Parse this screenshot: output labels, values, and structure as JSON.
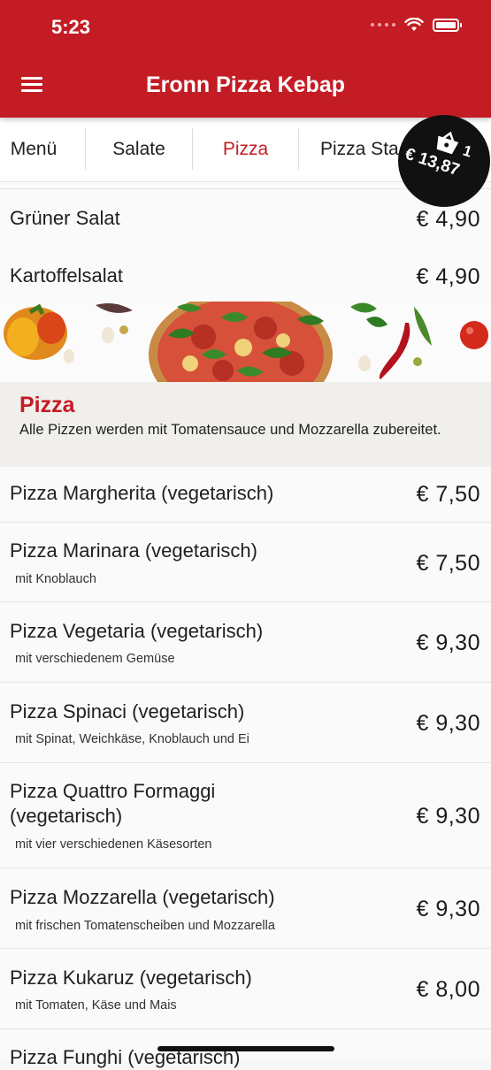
{
  "status": {
    "time": "5:23"
  },
  "header": {
    "title": "Eronn Pizza Kebap"
  },
  "tabs": [
    {
      "label": "Menü",
      "active": false
    },
    {
      "label": "Salate",
      "active": false
    },
    {
      "label": "Pizza",
      "active": true
    },
    {
      "label": "Pizza Sta",
      "active": false
    }
  ],
  "cart": {
    "count": "1",
    "total": "€ 13,87"
  },
  "salad_items": [
    {
      "name": "Grüner Salat",
      "price": "€ 4,90"
    },
    {
      "name": "Kartoffelsalat",
      "price": "€ 4,90"
    }
  ],
  "section": {
    "title": "Pizza",
    "description": "Alle Pizzen werden mit Tomatensauce und Mozzarella zubereitet."
  },
  "pizza_items": [
    {
      "name": "Pizza Margherita (vegetarisch)",
      "desc": "",
      "price": "€ 7,50"
    },
    {
      "name": "Pizza Marinara (vegetarisch)",
      "desc": "mit Knoblauch",
      "price": "€ 7,50"
    },
    {
      "name": "Pizza Vegetaria (vegetarisch)",
      "desc": "mit verschiedenem Gemüse",
      "price": "€ 9,30"
    },
    {
      "name": "Pizza Spinaci (vegetarisch)",
      "desc": "mit Spinat, Weichkäse, Knoblauch und Ei",
      "price": "€ 9,30"
    },
    {
      "name": "Pizza Quattro Formaggi (vegetarisch)",
      "desc": "mit vier verschiedenen Käsesorten",
      "price": "€ 9,30"
    },
    {
      "name": "Pizza Mozzarella (vegetarisch)",
      "desc": "mit frischen Tomatenscheiben und Mozzarella",
      "price": "€ 9,30"
    },
    {
      "name": "Pizza Kukaruz (vegetarisch)",
      "desc": "mit Tomaten, Käse und Mais",
      "price": "€ 8,00"
    },
    {
      "name": "Pizza Funghi (vegetarisch)",
      "desc": "",
      "price": ""
    }
  ],
  "colors": {
    "brand": "#c41c24",
    "section_bg": "#f1efec"
  }
}
